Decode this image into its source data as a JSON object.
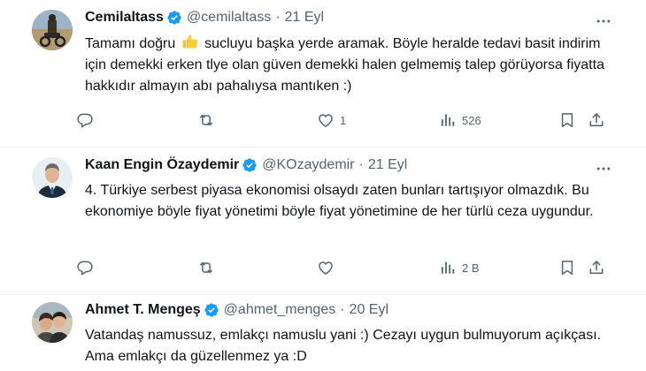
{
  "tweets": [
    {
      "author_name": "Cemilaltass",
      "handle": "@cemilaltass",
      "separator": "·",
      "date": "21 Eyl",
      "text_before_emoji": "Tamamı doğru",
      "emoji": "thumbs-up",
      "text_after_emoji": "sucluyu başka yerde aramak. Böyle heralde tedavi basit indirim için demekki erken tlye olan güven demekki halen gelmemiş talep görüyorsa fiyatta hakkıdır almayın abı pahalıysa mantıken :)",
      "counts": {
        "reply": "",
        "retweet": "",
        "like": "1",
        "views": "526"
      }
    },
    {
      "author_name": "Kaan Engin Özaydemir",
      "handle": "@KOzaydemir",
      "separator": "·",
      "date": "21 Eyl",
      "text": "4. Türkiye serbest piyasa ekonomisi olsaydı zaten bunları tartışıyor olmazdık. Bu ekonomiye böyle fiyat yönetimi böyle fiyat yönetimine de her türlü ceza uygundur.",
      "counts": {
        "reply": "",
        "retweet": "",
        "like": "",
        "views": "2 B"
      }
    },
    {
      "author_name": "Ahmet T. Mengeş",
      "handle": "@ahmet_menges",
      "separator": "·",
      "date": "20 Eyl",
      "text": "Vatandaş namussuz, emlakçı namuslu yani :) Cezayı uygun bulmuyorum açıkçası. Ama emlakçı da güzellenmez ya :D"
    }
  ],
  "colors": {
    "text": "#0f1419",
    "secondary": "#536471",
    "verified": "#1d9bf0",
    "divider": "#eff3f4"
  },
  "icons": [
    "verified-badge-icon",
    "more-icon",
    "reply-icon",
    "retweet-icon",
    "like-icon",
    "views-icon",
    "bookmark-icon",
    "share-icon"
  ]
}
